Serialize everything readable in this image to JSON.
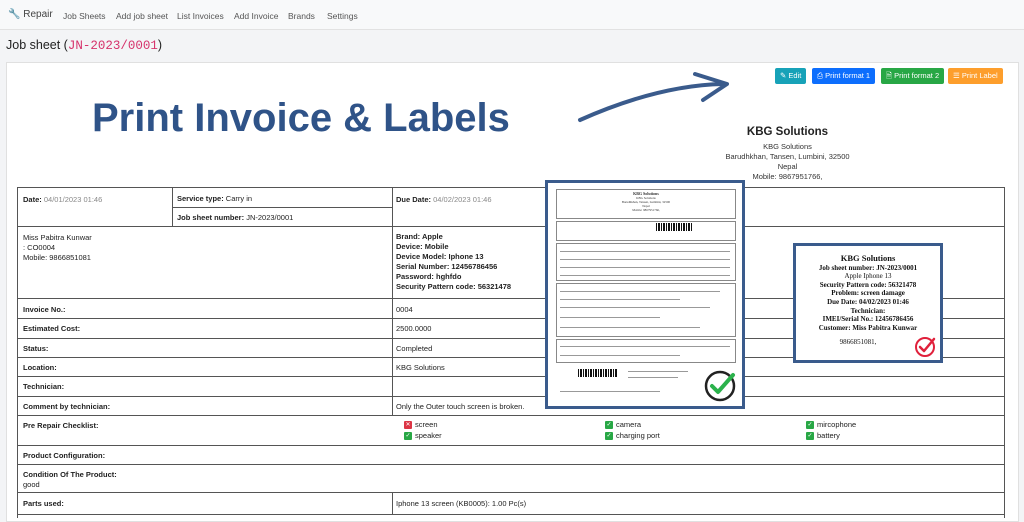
{
  "nav": {
    "brand": "Repair",
    "items": [
      "Job Sheets",
      "Add job sheet",
      "List Invoices",
      "Add Invoice",
      "Brands",
      "Settings"
    ]
  },
  "page": {
    "title_prefix": "Job sheet (",
    "code": "JN-2023/0001",
    "title_suffix": ")"
  },
  "toolbar": {
    "edit": "Edit",
    "print1": "Print format 1",
    "print2": "Print format 2",
    "label": "Print Label",
    "colors": {
      "edit": "#17a2b8",
      "print1": "#0d6efd",
      "print2": "#28a745",
      "label": "#fd9e2c"
    }
  },
  "promo": "Print Invoice & Labels",
  "company": {
    "name": "KBG Solutions",
    "line1": "KBG Solutions",
    "line2": "Barudhkhan, Tansen, Lumbini, 32500",
    "line3": "Nepal",
    "line4": "Mobile: 9867951766,"
  },
  "sheet": {
    "date_label": "Date:",
    "date": "04/01/2023 01:46",
    "service_label": "Service type:",
    "service": "Carry in",
    "jobno_label": "Job sheet number:",
    "jobno": "JN-2023/0001",
    "due_label": "Due Date:",
    "due": "04/02/2023 01:46",
    "cust_name": "Miss Pabitra Kunwar",
    "cust_code": ": CO0004",
    "cust_mobile": "Mobile: 9866851081",
    "brand": "Brand: Apple",
    "device": "Device: Mobile",
    "model": "Device Model: Iphone 13",
    "serial": "Serial Number: 12456786456",
    "password": "Password: hghfdo",
    "pattern": "Security Pattern code: 56321478",
    "rows": [
      {
        "label": "Invoice No.:",
        "value": "0004"
      },
      {
        "label": "Estimated Cost:",
        "value": "2500.0000"
      },
      {
        "label": "Status:",
        "value": "Completed"
      },
      {
        "label": "Location:",
        "value": "KBG Solutions"
      },
      {
        "label": "Technician:",
        "value": ""
      },
      {
        "label": "Comment by technician:",
        "value": "Only the Outer touch screen is broken."
      }
    ],
    "checklist_label": "Pre Repair Checklist:",
    "checklist": [
      {
        "name": "screen",
        "state": "x"
      },
      {
        "name": "camera",
        "state": "ok"
      },
      {
        "name": "mircophone",
        "state": "ok"
      },
      {
        "name": "speaker",
        "state": "ok"
      },
      {
        "name": "charging port",
        "state": "ok"
      },
      {
        "name": "battery",
        "state": "ok"
      }
    ],
    "product_config_label": "Product Configuration:",
    "condition_label": "Condition Of The Product:",
    "condition": "good",
    "parts_label": "Parts used:",
    "parts": "Iphone 13 screen (KB0005):  1.00 Pc(s)"
  },
  "label_card": {
    "name": "KBG Solutions",
    "l1": "Job sheet number: JN-2023/0001",
    "l2": "Apple Iphone 13",
    "l3": "Security Pattern code: 56321478",
    "l4": "Problem: screen damage",
    "l5": "Due Date: 04/02/2023 01:46",
    "l6": "Technician:",
    "l7": "IMEI/Serial No.: 12456786456",
    "l8": "Customer: Miss Pabitra Kunwar",
    "l9": "9866851081,"
  },
  "mini_invoice": {
    "name": "KBG Solutions",
    "sub": "KBG Solutions",
    "addr": "Barudhkhan, Tansen, Lumbini, 32500",
    "country": "Nepal",
    "mobile": "Mobile: 9867951766,"
  }
}
